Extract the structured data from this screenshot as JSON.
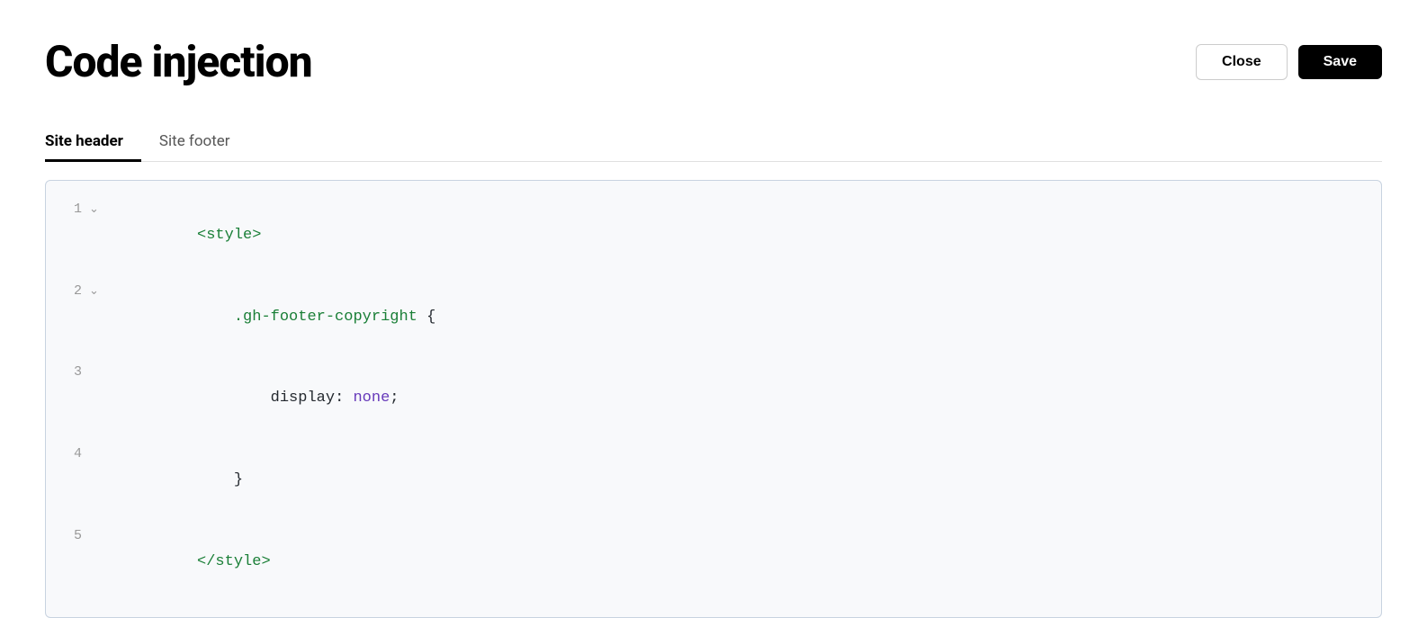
{
  "header": {
    "title": "Code injection",
    "close_label": "Close",
    "save_label": "Save"
  },
  "tabs": [
    {
      "id": "site-header",
      "label": "Site header",
      "active": true
    },
    {
      "id": "site-footer",
      "label": "Site footer",
      "active": false
    }
  ],
  "code_lines": [
    {
      "number": "1",
      "has_arrow": true,
      "content": [
        {
          "type": "tag",
          "text": "<style>"
        }
      ]
    },
    {
      "number": "2",
      "has_arrow": true,
      "content": [
        {
          "type": "indent",
          "text": "    "
        },
        {
          "type": "class",
          "text": ".gh-footer-copyright"
        },
        {
          "type": "plain",
          "text": " {"
        }
      ]
    },
    {
      "number": "3",
      "has_arrow": false,
      "content": [
        {
          "type": "indent",
          "text": "        "
        },
        {
          "type": "plain",
          "text": "display: "
        },
        {
          "type": "value",
          "text": "none"
        },
        {
          "type": "plain",
          "text": ";"
        }
      ]
    },
    {
      "number": "4",
      "has_arrow": false,
      "content": [
        {
          "type": "indent",
          "text": "    "
        },
        {
          "type": "plain",
          "text": "}"
        }
      ]
    },
    {
      "number": "5",
      "has_arrow": false,
      "content": [
        {
          "type": "tag",
          "text": "</style>"
        }
      ]
    }
  ]
}
